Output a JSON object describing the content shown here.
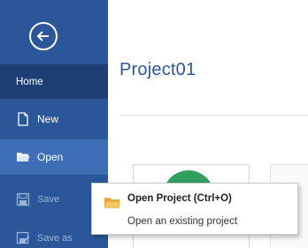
{
  "sidebar": {
    "back_icon": "back-arrow-icon",
    "items": [
      {
        "label": "Home",
        "icon": ""
      },
      {
        "label": "New",
        "icon": "new-document-icon"
      },
      {
        "label": "Open",
        "icon": "folder-open-icon"
      },
      {
        "label": "Save",
        "icon": "save-icon"
      },
      {
        "label": "Save as",
        "icon": "save-as-icon"
      }
    ]
  },
  "main": {
    "project_title": "Project01"
  },
  "tooltip": {
    "title": "Open Project (Ctrl+O)",
    "description": "Open an existing project",
    "icon": "folder-icon"
  },
  "colors": {
    "sidebar": "#2b579a",
    "sidebar_selected": "#1e3f73",
    "sidebar_hover": "#3d6eb6",
    "accent_text": "#2b579a",
    "tile_circle": "#2f9e5e",
    "folder": "#e8a93a"
  }
}
